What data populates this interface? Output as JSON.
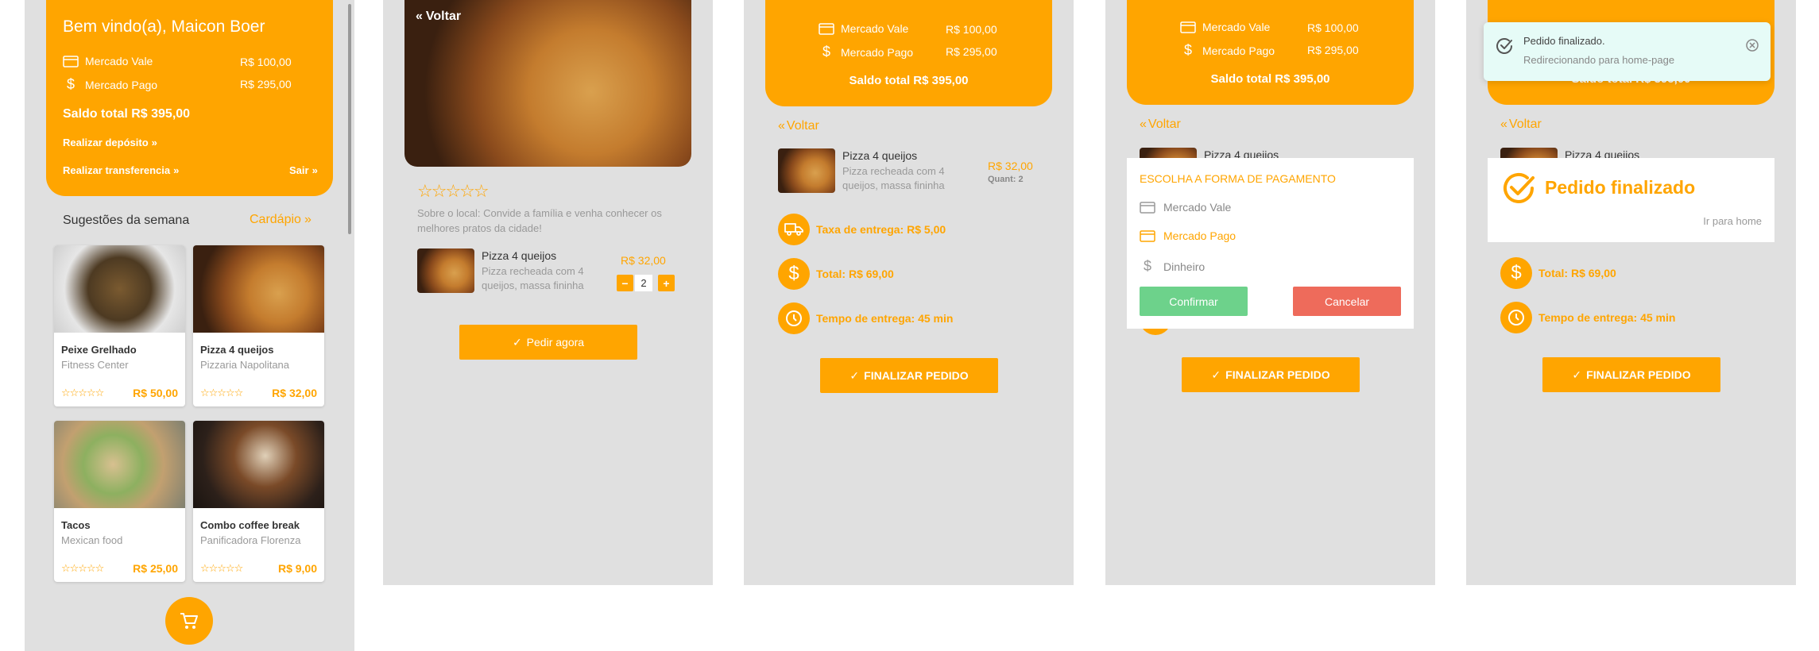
{
  "balance": {
    "greeting": "Bem vindo(a), Maicon Boer",
    "accounts": [
      {
        "label": "Mercado Vale",
        "value": "R$ 100,00",
        "icon": "credit-card-icon"
      },
      {
        "label": "Mercado Pago",
        "value": "R$ 295,00",
        "icon": "dollar-icon"
      }
    ],
    "total": "Saldo total R$ 395,00",
    "deposit": "Realizar depósito",
    "transfer": "Realizar transferencia",
    "logout": "Sair"
  },
  "home": {
    "section_title": "Sugestões da semana",
    "menu_link": "Cardápio",
    "stars": "☆☆☆☆☆",
    "cards": [
      {
        "name": "Peixe Grelhado",
        "place": "Fitness Center",
        "price": "R$ 50,00"
      },
      {
        "name": "Pizza 4 queijos",
        "place": "Pizzaria Napolitana",
        "price": "R$ 32,00"
      },
      {
        "name": "Tacos",
        "place": "Mexican food",
        "price": "R$ 25,00"
      },
      {
        "name": "Combo coffee break",
        "place": "Panificadora Florenza",
        "price": "R$ 9,00"
      }
    ]
  },
  "detail": {
    "back": "Voltar",
    "stars": "☆☆☆☆☆",
    "about": "Sobre o local: Convide a família e venha conhecer os melhores pratos da cidade!",
    "item_name": "Pizza 4 queijos",
    "item_desc": "Pizza recheada com 4 queijos, massa fininha",
    "item_price": "R$ 32,00",
    "qty": "2",
    "minus": "−",
    "plus": "+",
    "order_button": "Pedir agora"
  },
  "cart": {
    "back": "Voltar",
    "item_name": "Pizza 4 queijos",
    "item_desc": "Pizza recheada com 4 queijos, massa fininha",
    "item_price": "R$ 32,00",
    "item_qty": "Quant: 2",
    "delivery_fee": "Taxa de entrega: R$ 5,00",
    "total": "Total: R$ 69,00",
    "delivery_time": "Tempo de entrega: 45 min",
    "finish_button": "FINALIZAR PEDIDO"
  },
  "payment_modal": {
    "title": "ESCOLHA A FORMA DE PAGAMENTO",
    "options": [
      {
        "label": "Mercado Vale",
        "icon": "credit-card-icon",
        "selected": false
      },
      {
        "label": "Mercado Pago",
        "icon": "credit-card-icon",
        "selected": true
      },
      {
        "label": "Dinheiro",
        "icon": "dollar-icon",
        "selected": false
      }
    ],
    "confirm": "Confirmar",
    "cancel": "Cancelar"
  },
  "success": {
    "toast_title": "Pedido finalizado.",
    "toast_sub": "Redirecionando para home-page",
    "modal_title": "Pedido finalizado",
    "modal_link": "Ir para home",
    "partial_total": "Saldo total R$ 395,00"
  },
  "colors": {
    "accent": "#ffa500",
    "confirm": "#6dd28b",
    "cancel": "#ee6b5b",
    "toast_bg": "#e6fbf7",
    "screen_bg": "#e0e0e0"
  }
}
